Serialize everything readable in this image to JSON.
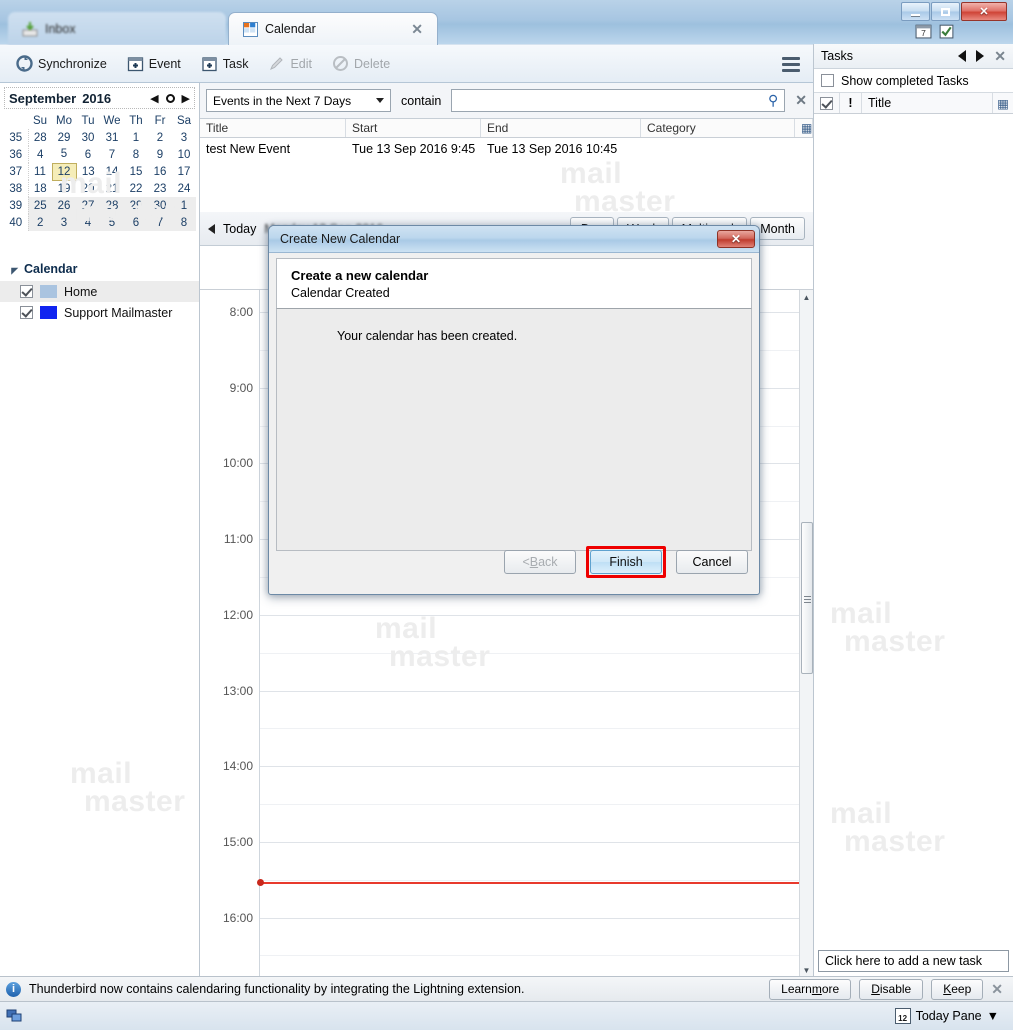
{
  "window": {
    "controls": {
      "minimize": "minimize-icon",
      "maximize": "maximize-icon",
      "close": "✕"
    },
    "header_icons": [
      "calendar-icon",
      "tasks-icon"
    ]
  },
  "tabs": [
    {
      "label": "Inbox",
      "icon": "inbox-icon",
      "active": false
    },
    {
      "label": "Calendar",
      "icon": "calendar-icon",
      "active": true,
      "close": "✕"
    }
  ],
  "toolbar": {
    "synchronize": "Synchronize",
    "event": "Event",
    "task": "Task",
    "edit": "Edit",
    "delete": "Delete",
    "menu": "app-menu-icon"
  },
  "minicalendar": {
    "month": "September",
    "year": "2016",
    "prev": "◀",
    "next": "▶",
    "daynames": [
      "Su",
      "Mo",
      "Tu",
      "We",
      "Th",
      "Fr",
      "Sa"
    ],
    "weeks": [
      {
        "num": "35",
        "shaded": false,
        "days": [
          {
            "d": "28",
            "dim": true
          },
          {
            "d": "29",
            "dim": true
          },
          {
            "d": "30",
            "dim": true
          },
          {
            "d": "31",
            "dim": true
          },
          {
            "d": "1",
            "bold": true
          },
          {
            "d": "2",
            "bold": true
          },
          {
            "d": "3"
          }
        ]
      },
      {
        "num": "36",
        "shaded": false,
        "days": [
          {
            "d": "4"
          },
          {
            "d": "5",
            "bold": true
          },
          {
            "d": "6"
          },
          {
            "d": "7"
          },
          {
            "d": "8"
          },
          {
            "d": "9",
            "bold": true
          },
          {
            "d": "10"
          }
        ]
      },
      {
        "num": "37",
        "shaded": false,
        "days": [
          {
            "d": "11"
          },
          {
            "d": "12",
            "today": true
          },
          {
            "d": "13",
            "bold": true
          },
          {
            "d": "14"
          },
          {
            "d": "15"
          },
          {
            "d": "16"
          },
          {
            "d": "17"
          }
        ]
      },
      {
        "num": "38",
        "shaded": false,
        "days": [
          {
            "d": "18"
          },
          {
            "d": "19"
          },
          {
            "d": "20"
          },
          {
            "d": "21"
          },
          {
            "d": "22",
            "bold": true
          },
          {
            "d": "23"
          },
          {
            "d": "24"
          }
        ]
      },
      {
        "num": "39",
        "shaded": true,
        "days": [
          {
            "d": "25"
          },
          {
            "d": "26"
          },
          {
            "d": "27"
          },
          {
            "d": "28"
          },
          {
            "d": "29"
          },
          {
            "d": "30"
          },
          {
            "d": "1",
            "dim": true
          }
        ]
      },
      {
        "num": "40",
        "shaded": true,
        "days": [
          {
            "d": "2",
            "dim": true
          },
          {
            "d": "3",
            "dim": true
          },
          {
            "d": "4",
            "dim": true
          },
          {
            "d": "5",
            "dim": true
          },
          {
            "d": "6",
            "dim": true
          },
          {
            "d": "7",
            "dim": true
          },
          {
            "d": "8",
            "dim": true
          }
        ]
      }
    ]
  },
  "calendars": {
    "title": "Calendar",
    "items": [
      {
        "name": "Home",
        "color": "#aac4e0",
        "checked": true,
        "selected": true
      },
      {
        "name": "Support Mailmaster",
        "color": "#1024f0",
        "checked": true,
        "selected": false
      }
    ]
  },
  "search": {
    "filter_selected": "Events in the Next 7 Days",
    "contain_label": "contain",
    "value": "",
    "placeholder": "",
    "search_icon": "search-icon",
    "clear_icon": "✕"
  },
  "eventlist": {
    "columns": [
      "Title",
      "Start",
      "End",
      "Category"
    ],
    "rows": [
      {
        "title": "test New Event",
        "start": "Tue 13 Sep 2016 9:45",
        "end": "Tue 13 Sep 2016 10:45",
        "category": ""
      }
    ]
  },
  "viewbar": {
    "today": "Today",
    "date": "Monday 12 Sep 2016",
    "views": [
      "Day",
      "Week",
      "Multiweek",
      "Month"
    ]
  },
  "daygrid": {
    "hours": [
      "8:00",
      "9:00",
      "10:00",
      "11:00",
      "12:00",
      "13:00",
      "14:00",
      "15:00",
      "16:00"
    ],
    "now_indicator_color": "#e8392c"
  },
  "tasks": {
    "title": "Tasks",
    "prev": "◀",
    "next": "▶",
    "close": "✕",
    "show_completed": "Show completed Tasks",
    "show_completed_checked": false,
    "columns": {
      "done": "✓",
      "priority": "!",
      "title": "Title"
    },
    "new_task_placeholder": "Click here to add a new task"
  },
  "notification": {
    "message": "Thunderbird now contains calendaring functionality by integrating the Lightning extension.",
    "buttons": [
      {
        "pre": "Learn ",
        "accel": "m",
        "post": "ore"
      },
      {
        "pre": "",
        "accel": "D",
        "post": "isable"
      },
      {
        "pre": "",
        "accel": "K",
        "post": "eep"
      }
    ],
    "close": "✕"
  },
  "statusbar": {
    "today_pane": "Today Pane",
    "today_pane_caret": "▼",
    "day_number": "12"
  },
  "dialog": {
    "title": "Create New Calendar",
    "close": "✕",
    "heading": "Create a new calendar",
    "subheading": "Calendar Created",
    "body_text": "Your calendar has been created.",
    "buttons": {
      "back": {
        "pre": "< ",
        "accel": "B",
        "post": "ack",
        "disabled": true
      },
      "finish": {
        "label": "Finish",
        "primary": true,
        "highlighted": true
      },
      "cancel": {
        "label": "Cancel"
      }
    }
  },
  "watermark": {
    "line1": "mail",
    "line2": "master"
  }
}
